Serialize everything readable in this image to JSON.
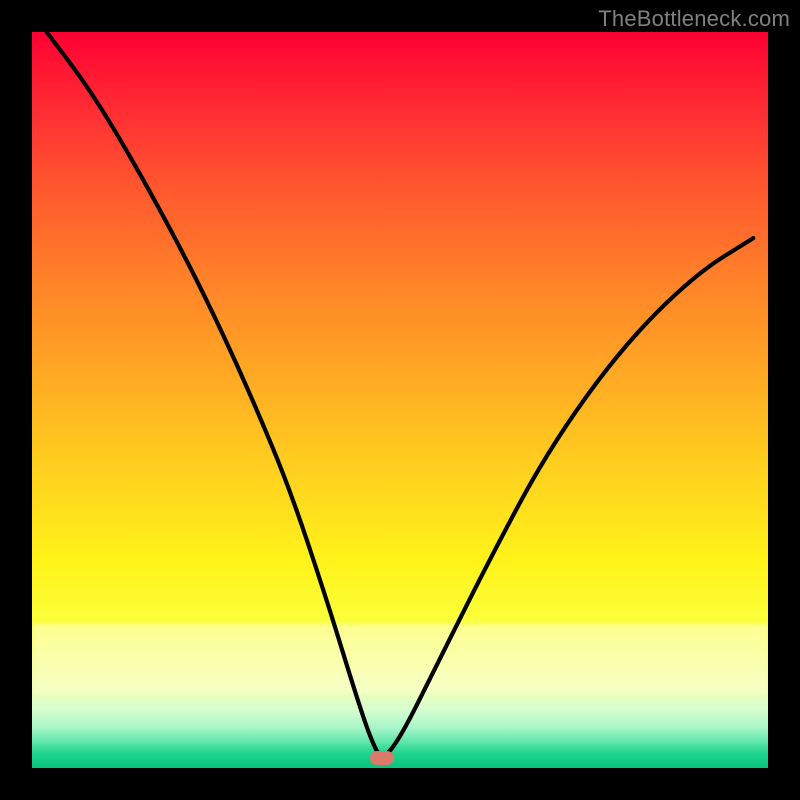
{
  "watermark": "TheBottleneck.com",
  "marker": {
    "x_pct": 47.5,
    "y_pct": 98.7
  },
  "chart_data": {
    "type": "line",
    "title": "",
    "xlabel": "",
    "ylabel": "",
    "xlim": [
      0,
      100
    ],
    "ylim": [
      0,
      100
    ],
    "annotations": [
      "TheBottleneck.com"
    ],
    "series": [
      {
        "name": "bottleneck-curve",
        "x": [
          2,
          8,
          14,
          20,
          25,
          30,
          35,
          40,
          44,
          46,
          47.5,
          50,
          55,
          62,
          70,
          80,
          90,
          98
        ],
        "y": [
          100,
          92,
          82,
          71,
          61,
          50,
          38,
          23,
          10,
          4,
          1,
          4,
          14,
          28,
          43,
          57,
          67,
          72
        ]
      }
    ],
    "background_gradient": {
      "direction": "vertical",
      "stops": [
        {
          "pct": 0,
          "color": "#ff0033"
        },
        {
          "pct": 12,
          "color": "#ff3333"
        },
        {
          "pct": 34,
          "color": "#ff8329"
        },
        {
          "pct": 60,
          "color": "#ffd21f"
        },
        {
          "pct": 80,
          "color": "#fbff3a"
        },
        {
          "pct": 92,
          "color": "#d8ffd0"
        },
        {
          "pct": 100,
          "color": "#08c47c"
        }
      ]
    },
    "marker": {
      "x": 47.5,
      "y": 1,
      "color": "#d97a6a",
      "shape": "pill"
    }
  }
}
